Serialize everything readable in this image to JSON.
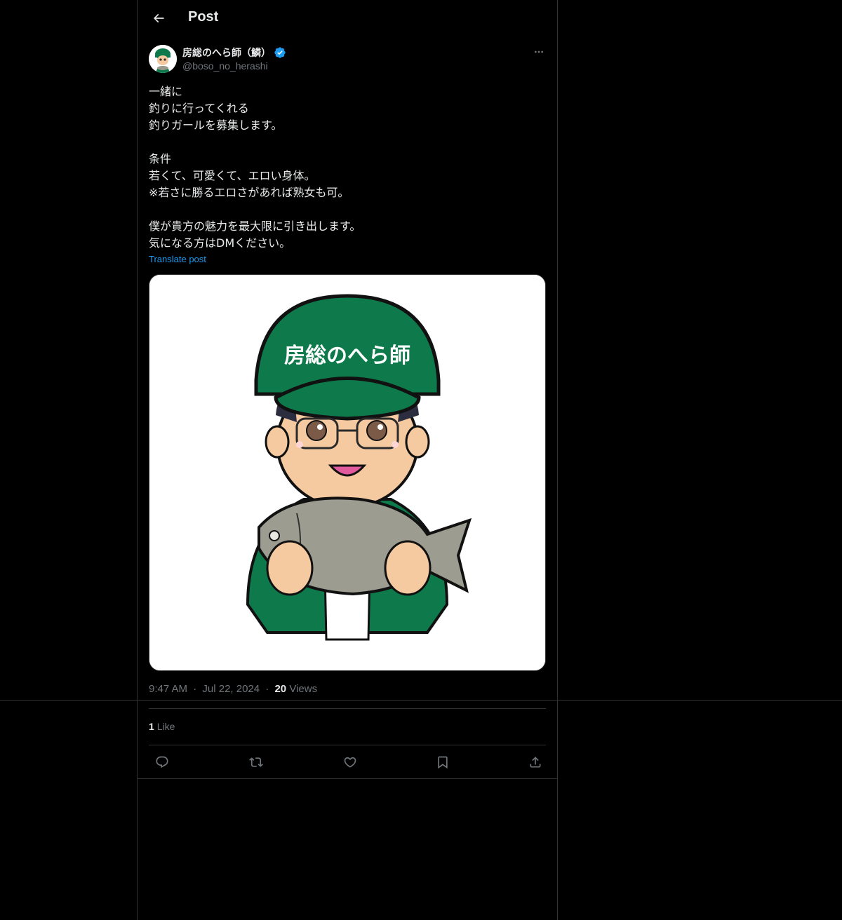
{
  "header": {
    "title": "Post"
  },
  "author": {
    "display_name": "房総のへら師（鱗）",
    "handle": "@boso_no_herashi",
    "verified": true
  },
  "post": {
    "text": "一緒に\n釣りに行ってくれる\n釣りガールを募集します。\n\n条件\n若くて、可愛くて、エロい身体。\n※若さに勝るエロさがあれば熟女も可。\n\n僕が貴方の魅力を最大限に引き出します。\n気になる方はDMください。",
    "translate_label": "Translate post",
    "image_text": "房総のへら師"
  },
  "meta": {
    "time": "9:47 AM",
    "date": "Jul 22, 2024",
    "views_count": "20",
    "views_label": "Views",
    "separator": "·"
  },
  "stats": {
    "likes_count": "1",
    "likes_label": "Like"
  },
  "icons": {
    "back": "arrow-left-icon",
    "more": "more-horizontal-icon",
    "verified": "verified-badge-icon",
    "reply": "reply-icon",
    "repost": "repost-icon",
    "like": "heart-icon",
    "bookmark": "bookmark-icon",
    "share": "share-icon"
  },
  "colors": {
    "accent": "#1d9bf0",
    "background": "#000000",
    "text": "#e7e9ea",
    "muted": "#71767b",
    "cap_green": "#0e7a4c"
  }
}
